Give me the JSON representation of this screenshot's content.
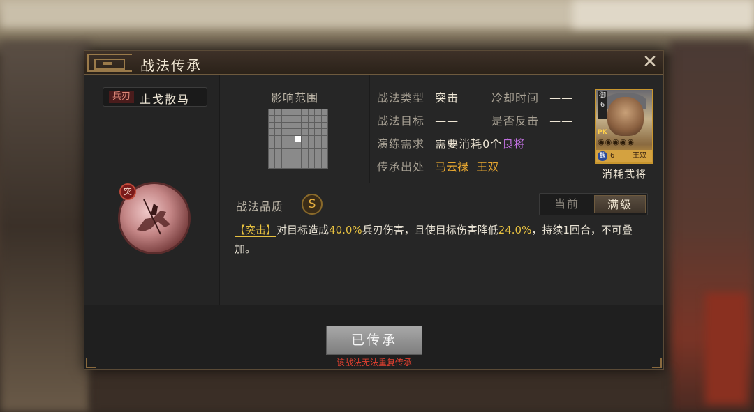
{
  "dialog": {
    "title": "战法传承",
    "close_label": "✕"
  },
  "skill": {
    "weapon_tag": "兵刃",
    "name": "止戈散马",
    "type_badge": "突",
    "range_label": "影响范围",
    "quality_label": "战法品质",
    "quality": "S"
  },
  "info": {
    "type_key": "战法类型",
    "type_val": "突击",
    "cooldown_key": "冷却时间",
    "cooldown_val": "——",
    "target_key": "战法目标",
    "target_val": "——",
    "counter_key": "是否反击",
    "counter_val": "——",
    "practice_key": "演练需求",
    "practice_prefix": "需要消耗0个",
    "practice_highlight": "良将",
    "source_key": "传承出处",
    "source_1": "马云禄",
    "source_2": "王双"
  },
  "general": {
    "cost": "御6",
    "stars": "◉◉◉◉◉",
    "level": "6",
    "name": "王双",
    "pk_badge": "PK",
    "faction": "魏",
    "consume_label": "消耗武将"
  },
  "toggle": {
    "current": "当前",
    "max": "满级",
    "selected": "满级"
  },
  "description": {
    "tag": "【突击】",
    "part1": "对目标造成",
    "num1": "40.0%",
    "part2": "兵刃伤害，且使目标伤害降低",
    "num2": "24.0%",
    "part3": "，持续1回合，不可叠加。"
  },
  "footer": {
    "button_label": "已传承",
    "warning": "该战法无法重复传承"
  },
  "colors": {
    "gold": "#e6a630",
    "highlight_yellow": "#e6c040",
    "purple": "#c070e0",
    "warning_red": "#e04030"
  }
}
